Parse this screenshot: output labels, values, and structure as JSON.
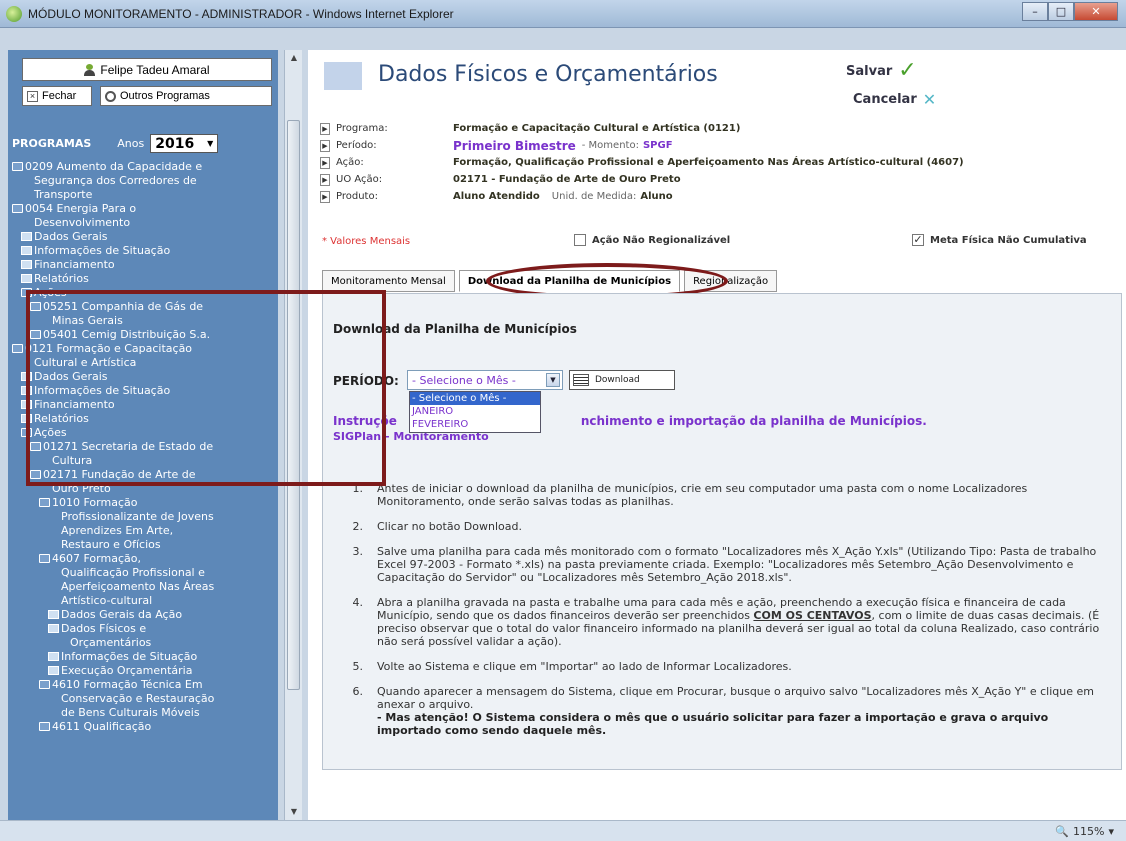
{
  "window": {
    "title": "MÓDULO MONITORAMENTO - ADMINISTRADOR - Windows Internet Explorer"
  },
  "sidebar": {
    "user": "Felipe Tadeu Amaral",
    "fechar": "Fechar",
    "outros": "Outros Programas",
    "programas": "PROGRAMAS",
    "anos_label": "Anos",
    "year": "2016",
    "tree": [
      {
        "indent": 0,
        "icon": "folder",
        "text": "0209 Aumento da Capacidade e"
      },
      {
        "indent": 1,
        "icon": "none",
        "text": "Segurança dos Corredores de"
      },
      {
        "indent": 1,
        "icon": "none",
        "text": "Transporte"
      },
      {
        "indent": 0,
        "icon": "open",
        "text": "0054 Energia Para o"
      },
      {
        "indent": 1,
        "icon": "none",
        "text": "Desenvolvimento"
      },
      {
        "indent": 1,
        "icon": "doc",
        "text": "Dados Gerais"
      },
      {
        "indent": 1,
        "icon": "doc",
        "text": "Informações de Situação"
      },
      {
        "indent": 1,
        "icon": "doc",
        "text": "Financiamento"
      },
      {
        "indent": 1,
        "icon": "doc",
        "text": "Relatórios"
      },
      {
        "indent": 1,
        "icon": "open",
        "text": "Ações"
      },
      {
        "indent": 2,
        "icon": "folder",
        "text": "05251 Companhia de Gás de"
      },
      {
        "indent": 3,
        "icon": "none",
        "text": "Minas Gerais"
      },
      {
        "indent": 2,
        "icon": "folder",
        "text": "05401 Cemig Distribuição S.a."
      },
      {
        "indent": 0,
        "icon": "open",
        "text": "0121 Formação e Capacitação"
      },
      {
        "indent": 1,
        "icon": "none",
        "text": "Cultural e Artística"
      },
      {
        "indent": 1,
        "icon": "doc",
        "text": "Dados Gerais"
      },
      {
        "indent": 1,
        "icon": "doc",
        "text": "Informações de Situação"
      },
      {
        "indent": 1,
        "icon": "doc",
        "text": "Financiamento"
      },
      {
        "indent": 1,
        "icon": "doc",
        "text": "Relatórios"
      },
      {
        "indent": 1,
        "icon": "open",
        "text": "Ações"
      },
      {
        "indent": 2,
        "icon": "folder",
        "text": "01271 Secretaria de Estado de"
      },
      {
        "indent": 3,
        "icon": "none",
        "text": "Cultura"
      },
      {
        "indent": 2,
        "icon": "open",
        "text": "02171 Fundação de Arte de"
      },
      {
        "indent": 3,
        "icon": "none",
        "text": "Ouro Preto"
      },
      {
        "indent": 3,
        "icon": "folder",
        "text": "1010 Formação"
      },
      {
        "indent": 4,
        "icon": "none",
        "text": "Profissionalizante de Jovens"
      },
      {
        "indent": 4,
        "icon": "none",
        "text": "Aprendizes Em Arte,"
      },
      {
        "indent": 4,
        "icon": "none",
        "text": "Restauro e Ofícios"
      },
      {
        "indent": 3,
        "icon": "open",
        "text": "4607 Formação,"
      },
      {
        "indent": 4,
        "icon": "none",
        "text": "Qualificação Profissional e"
      },
      {
        "indent": 4,
        "icon": "none",
        "text": "Aperfeiçoamento Nas Áreas"
      },
      {
        "indent": 4,
        "icon": "none",
        "text": "Artístico-cultural"
      },
      {
        "indent": 4,
        "icon": "doc",
        "text": "Dados Gerais da Ação"
      },
      {
        "indent": 4,
        "icon": "doc",
        "text": "Dados Físicos e"
      },
      {
        "indent": 5,
        "icon": "none",
        "text": "Orçamentários"
      },
      {
        "indent": 4,
        "icon": "doc",
        "text": "Informações de Situação"
      },
      {
        "indent": 4,
        "icon": "doc",
        "text": "Execução Orçamentária"
      },
      {
        "indent": 3,
        "icon": "folder",
        "text": "4610 Formação Técnica Em"
      },
      {
        "indent": 4,
        "icon": "none",
        "text": "Conservação e Restauração"
      },
      {
        "indent": 4,
        "icon": "none",
        "text": "de Bens Culturais Móveis"
      },
      {
        "indent": 3,
        "icon": "folder",
        "text": "4611 Qualificação"
      }
    ]
  },
  "header": {
    "title": "Dados Físicos e Orçamentários",
    "salvar": "Salvar",
    "cancelar": "Cancelar"
  },
  "info": {
    "programa_label": "Programa:",
    "programa": "Formação e Capacitação Cultural e Artística (0121)",
    "periodo_label": "Período:",
    "periodo": "Primeiro Bimestre",
    "momento_label": "- Momento:",
    "momento": "SPGF",
    "acao_label": "Ação:",
    "acao": "Formação, Qualificação Profissional e Aperfeiçoamento Nas Áreas Artístico-cultural (4607)",
    "uo_label": "UO Ação:",
    "uo": "02171 - Fundação de Arte de Ouro Preto",
    "produto_label": "Produto:",
    "produto": "Aluno Atendido",
    "unid_label": "Unid. de Medida:",
    "unid": "Aluno"
  },
  "flags": {
    "valores": "* Valores Mensais",
    "acao_nao_reg": "Ação Não Regionalizável",
    "meta_fisica": "Meta Física Não Cumulativa"
  },
  "tabs": [
    "Monitoramento Mensal",
    "Download da Planilha de Municípios",
    "Regionalização"
  ],
  "panel": {
    "title": "Download da Planilha de Municípios",
    "periodo_label": "PERÍODO:",
    "select_value": "- Selecione o Mês -",
    "download": "Download",
    "options": [
      "- Selecione o Mês -",
      "JANEIRO",
      "FEVEREIRO"
    ],
    "instr1a": "Instruçõe",
    "instr1b": "nchimento e importação da planilha de Municípios.",
    "instr2": "SIGPlan - Monitoramento",
    "steps": [
      {
        "n": "1.",
        "html": "Antes de iniciar o download da planilha de municípios, crie em seu computador uma pasta com o nome Localizadores Monitoramento, onde serão salvas todas as planilhas."
      },
      {
        "n": "2.",
        "html": "Clicar no botão Download."
      },
      {
        "n": "3.",
        "html": "Salve uma planilha para cada mês monitorado com o formato \"Localizadores mês X_Ação Y.xls\" (Utilizando Tipo: Pasta de trabalho Excel 97-2003 - Formato *.xls) na pasta previamente criada. Exemplo: \"Localizadores mês Setembro_Ação Desenvolvimento e Capacitação do Servidor\" ou \"Localizadores mês Setembro_Ação 2018.xls\"."
      },
      {
        "n": "4.",
        "pre": "Abra a planilha gravada na pasta e trabalhe uma para cada mês e ação, preenchendo a execução física e financeira de cada Município, sendo que os dados financeiros deverão ser preenchidos ",
        "strong": "COM OS CENTAVOS",
        "post": ", com o limite de duas casas decimais. (É preciso observar que o total do valor financeiro informado na planilha deverá ser igual ao total da coluna Realizado, caso contrário não será possível validar a ação)."
      },
      {
        "n": "5.",
        "html": "Volte ao Sistema e clique em \"Importar\" ao lado de Informar Localizadores."
      },
      {
        "n": "6.",
        "html": "Quando aparecer a mensagem do Sistema, clique em Procurar, busque o arquivo salvo \"Localizadores mês X_Ação Y\" e clique em anexar o arquivo.",
        "bold": "- Mas atenção! O Sistema considera o mês que o usuário solicitar para fazer a importação e grava o arquivo importado como sendo daquele mês."
      }
    ]
  },
  "status": {
    "zoom": "115%"
  },
  "colors": {
    "accent": "#7a33cc",
    "sidebar": "#5d88b8",
    "highlight": "#7d1b1b"
  }
}
